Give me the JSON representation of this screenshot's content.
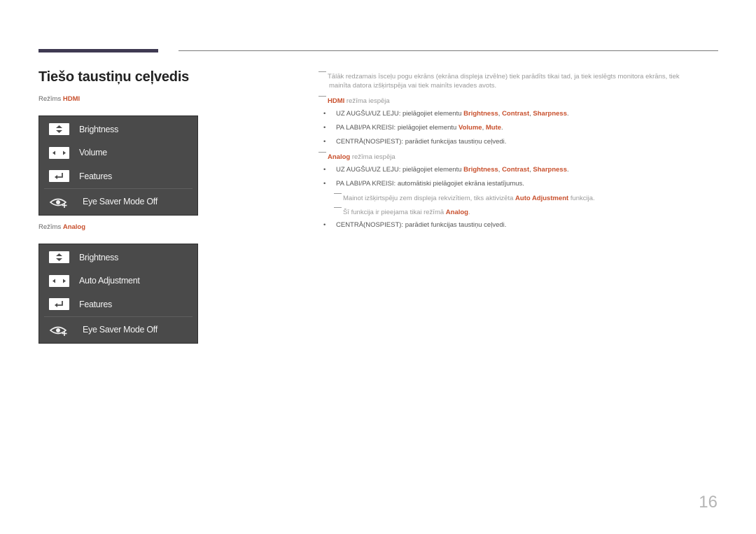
{
  "header": {
    "title": "Tiešo taustiņu ceļvedis"
  },
  "hdmi_section": {
    "mode_prefix": "Režīms",
    "mode_name": "HDMI",
    "osd_items": [
      {
        "icon": "up-down-arrows-icon",
        "label": "Brightness"
      },
      {
        "icon": "left-right-arrows-icon",
        "label": "Volume"
      },
      {
        "icon": "enter-return-icon",
        "label": "Features"
      }
    ],
    "eye_saver": {
      "icon": "eye-saver-icon",
      "label": "Eye Saver Mode Off"
    }
  },
  "analog_section": {
    "mode_prefix": "Režīms",
    "mode_name": "Analog",
    "osd_items": [
      {
        "icon": "up-down-arrows-icon",
        "label": "Brightness"
      },
      {
        "icon": "left-right-arrows-icon",
        "label": "Auto Adjustment"
      },
      {
        "icon": "enter-return-icon",
        "label": "Features"
      }
    ],
    "eye_saver": {
      "icon": "eye-saver-icon",
      "label": "Eye Saver Mode Off"
    }
  },
  "notes": {
    "intro_line1": "Tālāk redzamais īsceļu pogu ekrāns (ekrāna displeja izvēlne) tiek parādīts tikai tad, ja tiek ieslēgts monitora ekrāns, tiek",
    "intro_line2": "mainīta datora izšķirtspēja vai tiek mainīts ievades avots.",
    "hdmi_heading": {
      "highlight": "HDMI",
      "text": " režīma iespēja"
    },
    "hdmi_bullets": [
      {
        "text": "UZ AUGŠU/UZ LEJU: pielāgojiet elementu ",
        "hl1": "Brightness",
        "sep1": ", ",
        "hl2": "Contrast",
        "sep2": ", ",
        "hl3": "Sharpness",
        "end": "."
      },
      {
        "text": "PA LABI/PA KREISI: pielāgojiet elementu ",
        "hl1": "Volume",
        "sep1": ", ",
        "hl2": "Mute",
        "end": "."
      },
      {
        "text": "CENTRĀ(NOSPIEST): parādiet funkcijas taustiņu ceļvedi."
      }
    ],
    "analog_heading": {
      "highlight": "Analog",
      "text": " režīma iespēja"
    },
    "analog_bullets": [
      {
        "text": "UZ AUGŠU/UZ LEJU: pielāgojiet elementu ",
        "hl1": "Brightness",
        "sep1": ", ",
        "hl2": "Contrast",
        "sep2": ", ",
        "hl3": "Sharpness",
        "end": "."
      },
      {
        "text": "PA LABI/PA KREISI: automātiski pielāgojiet ekrāna iestatījumus."
      },
      {
        "text": "CENTRĀ(NOSPIEST): parādiet funkcijas taustiņu ceļvedi."
      }
    ],
    "analog_subnotes": [
      {
        "text": "Mainot izšķirtspēju zem displeja rekvizītiem, tiks aktivizēta ",
        "hl": "Auto Adjustment",
        "end": " funkcija."
      },
      {
        "text": "Šī funkcija ir pieejama tikai režīmā ",
        "hl": "Analog",
        "end": "."
      }
    ],
    "bullet_char": "•"
  },
  "page_number": "16"
}
